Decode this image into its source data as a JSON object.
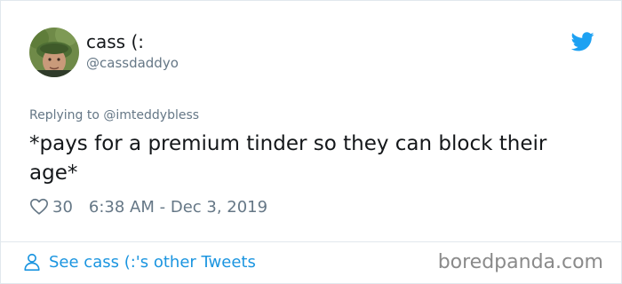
{
  "tweet": {
    "author": {
      "display_name": "cass (:",
      "handle": "@cassdaddyo",
      "avatar_icon": "profile-photo"
    },
    "platform_icon": "twitter-bird-icon",
    "reply_context": {
      "prefix": "Replying to",
      "mention": "@imteddybless"
    },
    "text": "*pays for a premium tinder so they can block their age*",
    "likes": "30",
    "timestamp": "6:38 AM - Dec 3, 2019"
  },
  "footer": {
    "other_tweets_link": "See cass (:'s other Tweets",
    "watermark": "boredpanda.com"
  },
  "colors": {
    "link_blue": "#1b95e0",
    "twitter_blue": "#1da1f2",
    "muted_gray": "#657786",
    "text_dark": "#14171a"
  }
}
